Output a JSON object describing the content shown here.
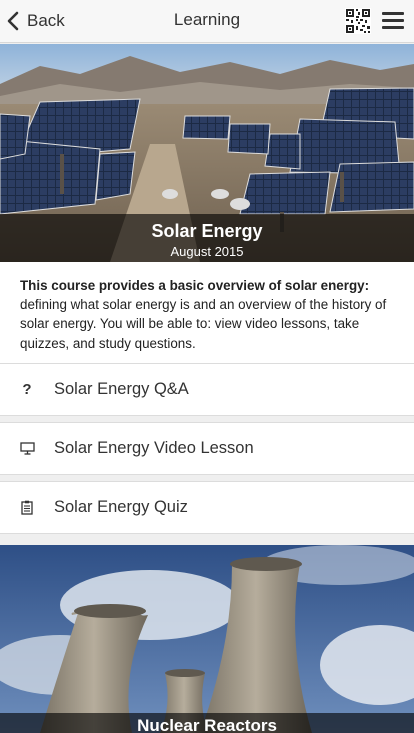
{
  "header": {
    "back_label": "Back",
    "title": "Learning",
    "qr_icon": "qr-code-icon",
    "menu_icon": "hamburger-menu-icon"
  },
  "courses": [
    {
      "title": "Solar Energy",
      "date": "August 2015",
      "description_bold": "This course provides a basic overview of solar energy:",
      "description_rest": " defining what solar energy is and an overview of the history of solar energy. You will be able to: view video lessons, take quizzes, and study questions.",
      "items": [
        {
          "label": "Solar Energy Q&A",
          "icon": "question-mark-icon"
        },
        {
          "label": "Solar Energy Video Lesson",
          "icon": "monitor-icon"
        },
        {
          "label": "Solar Energy Quiz",
          "icon": "clipboard-icon"
        }
      ]
    },
    {
      "title": "Nuclear Reactors"
    }
  ],
  "colors": {
    "topbar_bg": "#f7f7f7",
    "caption_overlay": "rgba(0,0,0,0.62)",
    "page_bg": "#efefef"
  }
}
